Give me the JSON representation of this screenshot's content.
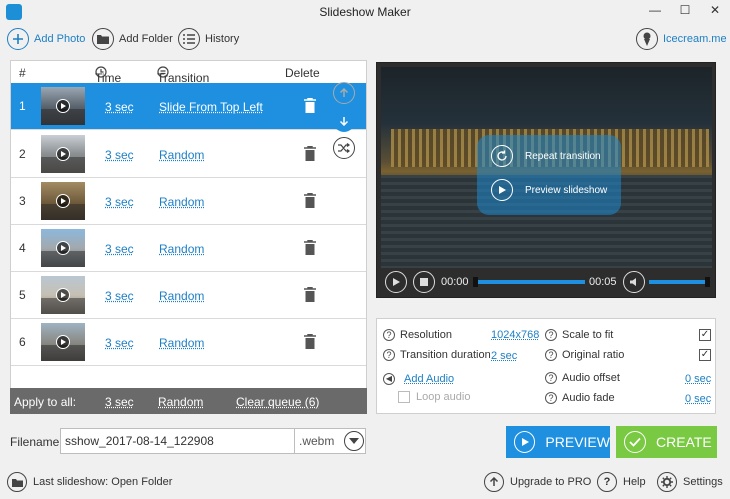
{
  "window": {
    "title": "Slideshow Maker"
  },
  "toolbar": {
    "add_photo": "Add Photo",
    "add_folder": "Add Folder",
    "history": "History",
    "brand": "Icecream.me"
  },
  "queue": {
    "headers": {
      "num": "#",
      "time": "Time",
      "transition": "Transition",
      "delete": "Delete"
    },
    "rows": [
      {
        "num": "1",
        "time": "3 sec",
        "transition": "Slide From Top Left"
      },
      {
        "num": "2",
        "time": "3 sec",
        "transition": "Random"
      },
      {
        "num": "3",
        "time": "3 sec",
        "transition": "Random"
      },
      {
        "num": "4",
        "time": "3 sec",
        "transition": "Random"
      },
      {
        "num": "5",
        "time": "3 sec",
        "transition": "Random"
      },
      {
        "num": "6",
        "time": "3 sec",
        "transition": "Random"
      }
    ],
    "apply_all": {
      "label": "Apply to all:",
      "time": "3 sec",
      "transition": "Random",
      "clear": "Clear queue (6)"
    }
  },
  "preview": {
    "repeat_transition": "Repeat transition",
    "preview_slideshow": "Preview slideshow",
    "time_current": "00:00",
    "time_total": "00:05",
    "progress": 0,
    "volume": 1
  },
  "settings": {
    "resolution_label": "Resolution",
    "resolution_value": "1024x768",
    "transition_duration_label": "Transition duration",
    "transition_duration_value": "2 sec",
    "add_audio": "Add Audio",
    "loop_audio": "Loop audio",
    "scale_to_fit": "Scale to fit",
    "original_ratio": "Original ratio",
    "audio_offset_label": "Audio offset",
    "audio_offset_value": "0 sec",
    "audio_fade_label": "Audio fade",
    "audio_fade_value": "0 sec"
  },
  "output": {
    "filename_label": "Filename:",
    "filename_value": "sshow_2017-08-14_122908",
    "extension": ".webm"
  },
  "actions": {
    "preview": "PREVIEW",
    "create": "CREATE"
  },
  "footer": {
    "last_slideshow": "Last slideshow: Open Folder",
    "upgrade": "Upgrade to PRO",
    "help": "Help",
    "settings": "Settings"
  },
  "colors": {
    "accent_blue": "#1e90df",
    "create_green": "#7ac943"
  }
}
